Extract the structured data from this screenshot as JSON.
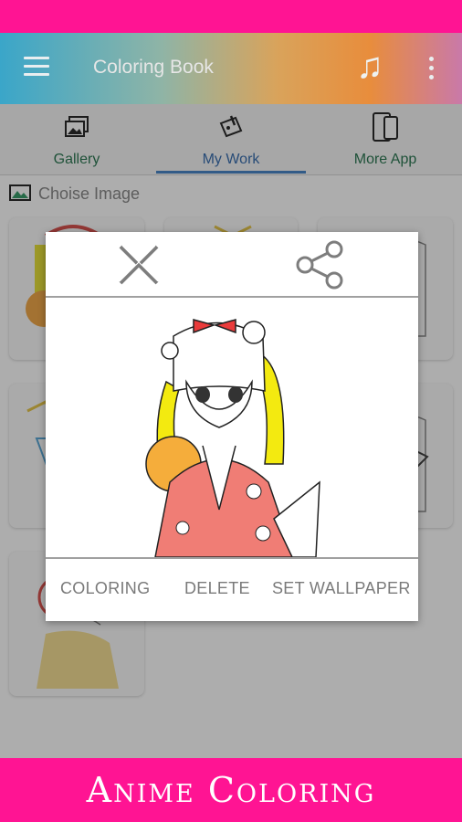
{
  "app": {
    "title": "Coloring Book"
  },
  "tabs": [
    {
      "label": "Gallery",
      "icon": "gallery-icon"
    },
    {
      "label": "My Work",
      "icon": "palette-icon",
      "active": true
    },
    {
      "label": "More App",
      "icon": "phone-icon"
    }
  ],
  "section": {
    "title": "Choise Image",
    "icon": "image-icon"
  },
  "dialog": {
    "close_icon": "close-icon",
    "share_icon": "share-icon",
    "actions": {
      "coloring": "COLORING",
      "delete": "DELETE",
      "set_wallpaper": "SET WALLPAPER"
    }
  },
  "banner": {
    "text": "Anime Coloring"
  },
  "colors": {
    "brand_pink": "#ff1493",
    "tab_active": "#3a6fb0",
    "tab_text": "#2f7a55"
  }
}
